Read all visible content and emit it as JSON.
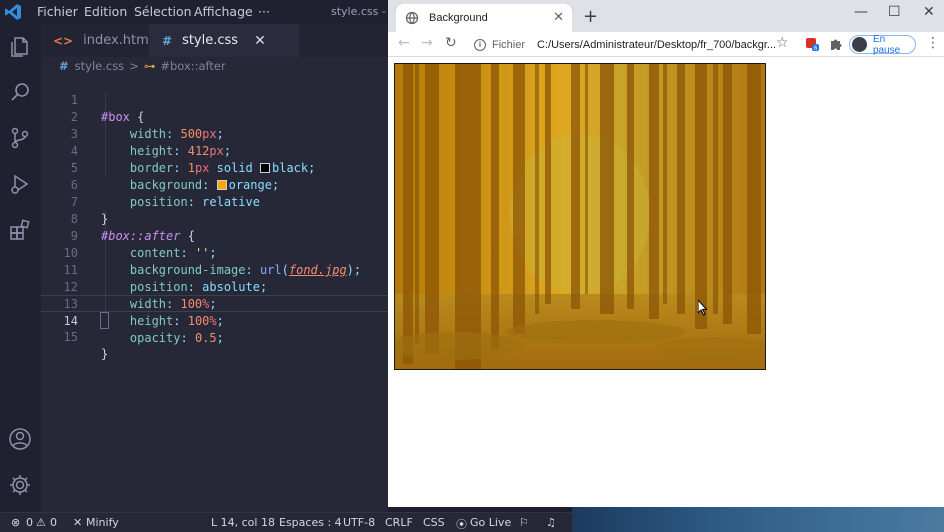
{
  "vscode": {
    "menu": [
      "Fichier",
      "Edition",
      "Sélection",
      "Affichage",
      "···"
    ],
    "window_title": "style.css - Ex",
    "tabs": [
      {
        "label": "index.html",
        "icon": "<>"
      },
      {
        "label": "style.css",
        "icon": "#",
        "close": "✕"
      }
    ],
    "breadcrumb": {
      "file": "style.css",
      "separator": ">",
      "symbol": "#box::after"
    },
    "current_line": 14,
    "lines": [
      {
        "n": "1"
      },
      {
        "n": "2"
      },
      {
        "n": "3"
      },
      {
        "n": "4"
      },
      {
        "n": "5"
      },
      {
        "n": "6"
      },
      {
        "n": "7"
      },
      {
        "n": "8"
      },
      {
        "n": "9"
      },
      {
        "n": "10"
      },
      {
        "n": "11"
      },
      {
        "n": "12"
      },
      {
        "n": "13"
      },
      {
        "n": "14"
      },
      {
        "n": "15"
      }
    ],
    "code": {
      "l1_sel": "#box",
      "l1_brace": " {",
      "l2_prop": "width",
      "l2_num": "500",
      "l2_unit": "px",
      "l3_prop": "height",
      "l3_num": "412",
      "l3_unit": "px",
      "l4_prop": "border",
      "l4_num": "1",
      "l4_unit": "px",
      "l4_kw": "solid",
      "l4_color": "black",
      "l5_prop": "background",
      "l5_color": "orange",
      "l6_prop": "position",
      "l6_val": "relative",
      "l7_brace": "}",
      "l8_sel": "#box::after",
      "l8_brace": " {",
      "l9_prop": "content",
      "l9_str": "''",
      "l10_prop": "background-image",
      "l10_fn": "url",
      "l10_url": "fond.jpg",
      "l11_prop": "position",
      "l11_val": "absolute",
      "l12_prop": "width",
      "l12_num": "100",
      "l12_unit": "%",
      "l13_prop": "height",
      "l13_num": "100",
      "l13_unit": "%",
      "l14_prop": "opacity",
      "l14_num": "0.5",
      "l15_brace": "}"
    },
    "swatch_colors": {
      "black": "#000000",
      "orange": "#ffa500"
    }
  },
  "statusbar": {
    "errors": "0",
    "warnings": "0",
    "minify": "Minify",
    "position": "L 14, col 18",
    "spaces": "Espaces : 4",
    "encoding": "UTF-8",
    "eol": "CRLF",
    "language": "CSS",
    "golive": "Go Live"
  },
  "chrome": {
    "tab_title": "Background",
    "tab_close": "✕",
    "new_tab": "+",
    "window_controls": [
      "—",
      "☐",
      "✕"
    ],
    "scheme": "Fichier",
    "url": "C:/Users/Administrateur/Desktop/fr_700/backgr...",
    "profile": "En pause",
    "badge": "6",
    "box_color": "#d99a10"
  }
}
